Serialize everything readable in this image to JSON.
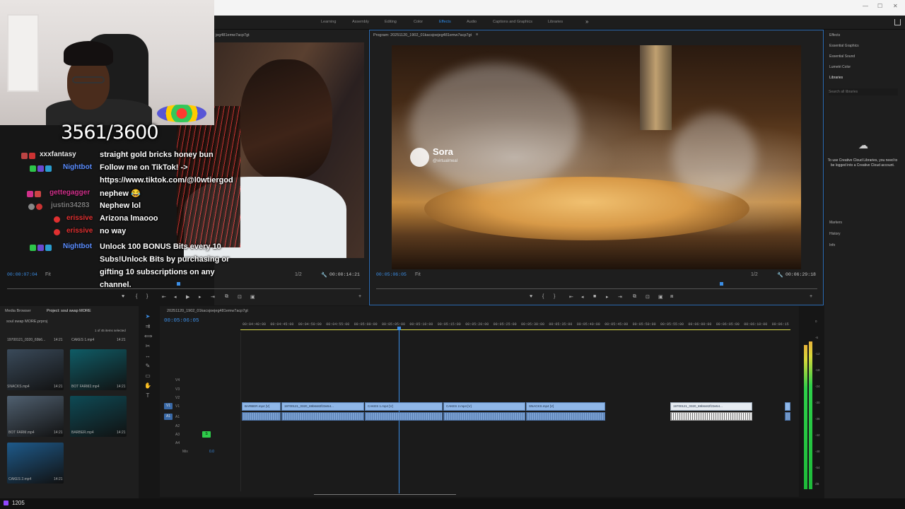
{
  "workspaces": [
    {
      "label": "Learning",
      "active": false
    },
    {
      "label": "Assembly",
      "active": false
    },
    {
      "label": "Editing",
      "active": false
    },
    {
      "label": "Color",
      "active": false
    },
    {
      "label": "Effects",
      "active": true
    },
    {
      "label": "Audio",
      "active": false
    },
    {
      "label": "Captions and Graphics",
      "active": false
    },
    {
      "label": "Libraries",
      "active": false
    }
  ],
  "workspace_more": "»",
  "window_controls": {
    "minimize": "—",
    "maximize": "☐",
    "close": "✕"
  },
  "source_monitor": {
    "title": "jeg481emw7acp7gt",
    "timecode_current": "00:00:07:04",
    "fit": "Fit",
    "resolution": "1/2",
    "timecode_duration": "00:00:14:21"
  },
  "program_monitor": {
    "title": "Program: 20251120_1902_01kacsjoejeg481emw7acp7gt",
    "menu": "≡",
    "timecode_current": "00:05:06:05",
    "fit": "Fit",
    "resolution": "1/2",
    "timecode_duration": "00:06:29:18",
    "watermark": {
      "brand": "Sora",
      "handle": "@virtualmeal"
    }
  },
  "overlay": {
    "counter": "3561/3600",
    "chat": [
      {
        "user": "xxxfantasy",
        "user_color": "#e8e8e8",
        "message": "straight gold bricks honey bun"
      },
      {
        "user": "Nightbot",
        "user_color": "#5a8dff",
        "message": "Follow me on TikTok! ->"
      },
      {
        "user": "",
        "user_color": "#ffffff",
        "message": "https://www.tiktok.com/@l0wtiergod"
      },
      {
        "user": "gettegagger",
        "user_color": "#d0308a",
        "message": "nephew 😂"
      },
      {
        "user": "justin34283",
        "user_color": "#7a7a7a",
        "message": "Nephew lol"
      },
      {
        "user": "erissive",
        "user_color": "#e03030",
        "message": "Arizona lmaooo"
      },
      {
        "user": "erissive",
        "user_color": "#e03030",
        "message": "no way"
      },
      {
        "user": "Nightbot",
        "user_color": "#5a8dff",
        "message": "Unlock 100 BONUS Bits every 10"
      },
      {
        "user": "",
        "user_color": "#ffffff",
        "message": "Subs!Unlock Bits by purchasing or"
      },
      {
        "user": "",
        "user_color": "#ffffff",
        "message": "gifting 10 subscriptions on any"
      },
      {
        "user": "",
        "user_color": "#ffffff",
        "message": "channel."
      }
    ]
  },
  "project_panel": {
    "tabs": [
      "Media Browser",
      "Project: soul swap MORE"
    ],
    "project_file": "soul swap MORE.prproj",
    "selection_info": "1 of 45 items selected",
    "items": [
      {
        "name": "19700121_0320_69b6...",
        "duration": "14:21",
        "color": "#3a4a5a"
      },
      {
        "name": "CAKES 1.mp4",
        "duration": "14:21",
        "color": "#0f5c66"
      },
      {
        "name": "SNACKS.mp4",
        "duration": "14:21",
        "color": "#506070"
      },
      {
        "name": "BOT FARM2.mp4",
        "duration": "14:21",
        "color": "#0e4a55"
      },
      {
        "name": "BOT FARM.mp4",
        "duration": "14:21",
        "color": "#1e5a8a"
      },
      {
        "name": "BARBER.mp4",
        "duration": "14:21",
        "color": "#7a5a3a"
      },
      {
        "name": "CAKES 2.mp4",
        "duration": "14:21",
        "color": "#8a5a2a"
      }
    ]
  },
  "timeline": {
    "sequence_tab": "20251120_1902_01kacsjoejeg481emw7acp7gt",
    "timecode": "00:05:06:05",
    "ruler": [
      "00:04:40:00",
      "00:04:45:00",
      "00:04:50:00",
      "00:04:55:00",
      "00:05:00:00",
      "00:05:05:00",
      "00:05:10:00",
      "00:05:15:00",
      "00:05:20:00",
      "00:05:25:00",
      "00:05:30:00",
      "00:05:35:00",
      "00:05:40:00",
      "00:05:45:00",
      "00:05:50:00",
      "00:05:55:00",
      "00:06:00:00",
      "00:06:05:00",
      "00:06:10:00",
      "00:06:15"
    ],
    "video_tracks": [
      "V4",
      "V3",
      "V2",
      "V1"
    ],
    "audio_tracks": [
      "A1",
      "A2",
      "A3",
      "A4"
    ],
    "mix_label": "Mix",
    "mix_value": "0.0",
    "clips_video": [
      {
        "label": "BARBER.mp4 [V]"
      },
      {
        "label": "19700121_0320_69b6s82f23e54..."
      },
      {
        "label": "CAKES 1.mp4 [V]"
      },
      {
        "label": "CAKES 2.mp4 [V]"
      },
      {
        "label": "SNACKS.mp4 [V]"
      },
      {
        "label": "19700121_0320_69b6s82f23e54..."
      }
    ]
  },
  "meter_scale": [
    "0",
    "-6",
    "-12",
    "-18",
    "-24",
    "-30",
    "-36",
    "-42",
    "-48",
    "-54",
    "dB"
  ],
  "meter_levels": {
    "left": 0.88,
    "right": 0.9
  },
  "right_panel": {
    "items": [
      "Effects",
      "Essential Graphics",
      "Essential Sound",
      "Lumetri Color",
      "Libraries"
    ],
    "search_placeholder": "Search all libraries",
    "cc_message": "To use Creative Cloud Libraries, you need to be logged into a Creative Cloud account.",
    "lower_items": [
      "Markers",
      "History",
      "Info"
    ]
  },
  "status": {
    "count": "1205"
  }
}
